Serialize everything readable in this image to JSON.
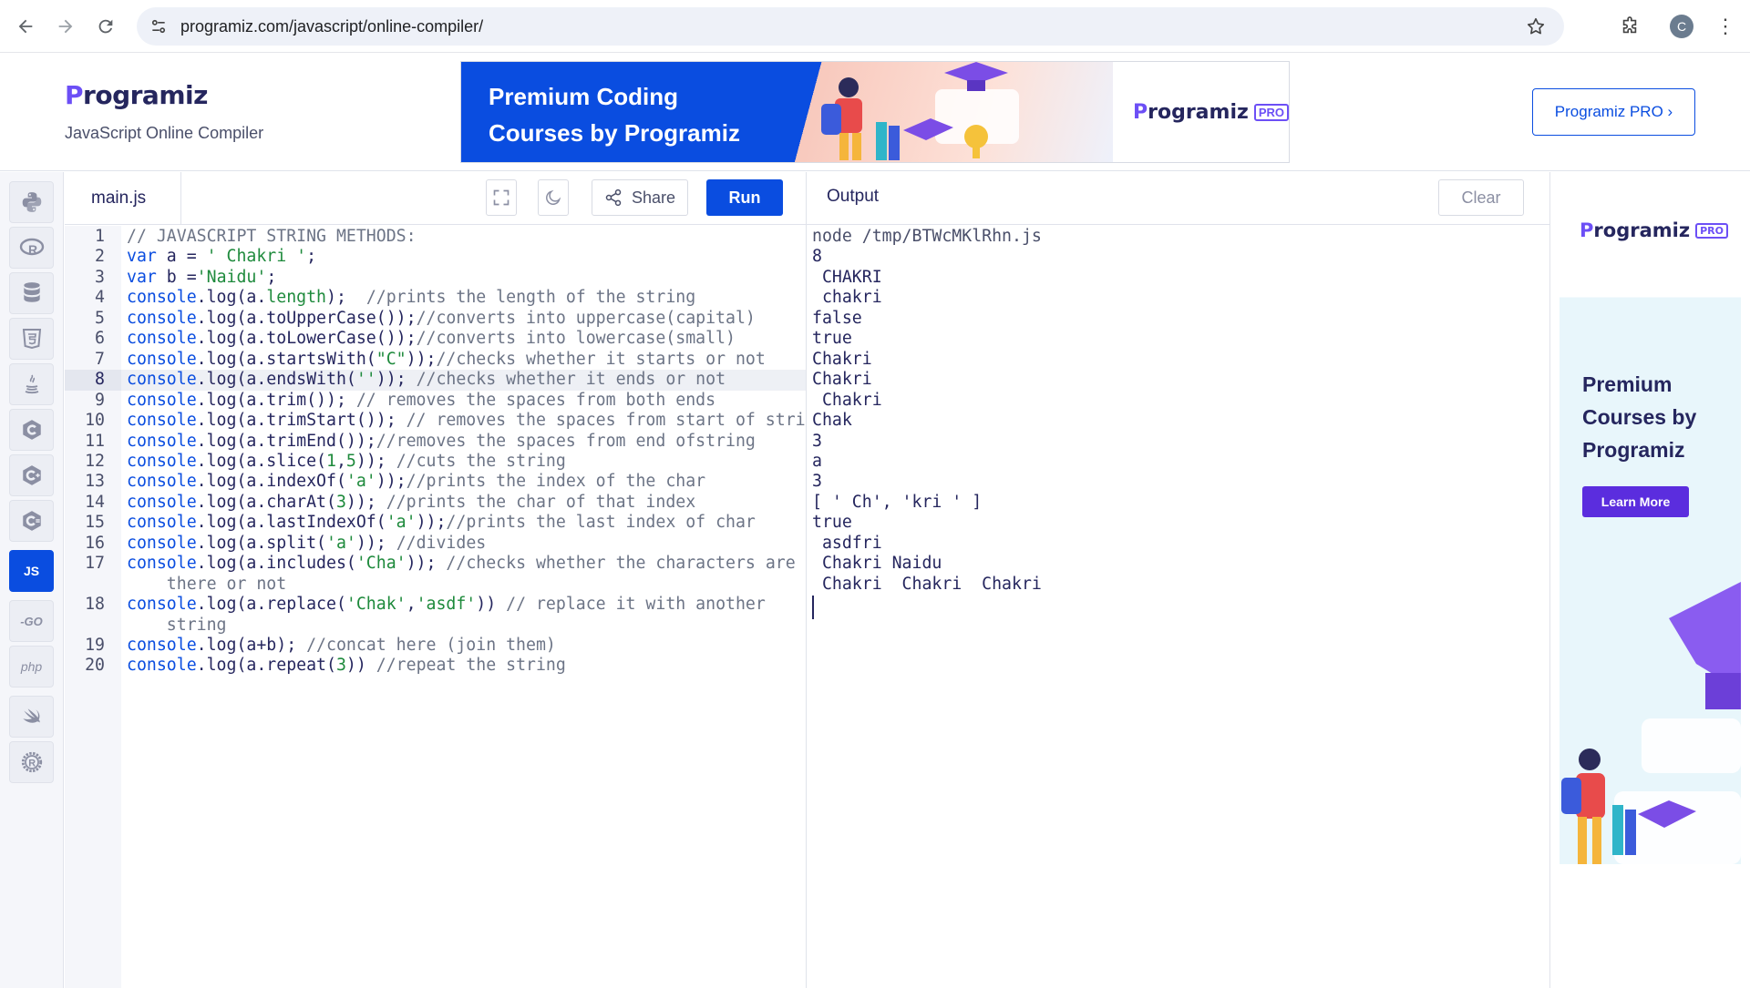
{
  "browser": {
    "url": "programiz.com/javascript/online-compiler/",
    "profile_initial": "C"
  },
  "header": {
    "logo_text": "rogramiz",
    "logo_mark": "P",
    "subtitle": "JavaScript Online Compiler",
    "banner_line1": "Premium Coding",
    "banner_line2": "Courses by Programiz",
    "banner_logo": "rogramiz",
    "banner_badge": "PRO",
    "pro_button": "Programiz PRO ›"
  },
  "rail": {
    "items": [
      "python",
      "r",
      "sql",
      "html",
      "java",
      "c",
      "cpp",
      "csharp",
      "JS",
      "GO",
      "php",
      "swift",
      "rust"
    ],
    "active": "JS",
    "go_label": "-GO",
    "php_label": "php"
  },
  "editor": {
    "file_name": "main.js",
    "share_label": "Share",
    "run_label": "Run",
    "current_line": 8,
    "lines": [
      {
        "n": "1",
        "text": "// JAVASCRIPT STRING METHODS:"
      },
      {
        "n": "2",
        "text": "var a = ' Chakri ';"
      },
      {
        "n": "3",
        "text": "var b ='Naidu';"
      },
      {
        "n": "4",
        "text": "console.log(a.length);  //prints the length of the string"
      },
      {
        "n": "5",
        "text": "console.log(a.toUpperCase());//converts into uppercase(capital)"
      },
      {
        "n": "6",
        "text": "console.log(a.toLowerCase());//converts into lowercase(small)"
      },
      {
        "n": "7",
        "text": "console.log(a.startsWith(\"C\"));//checks whether it starts or not"
      },
      {
        "n": "8",
        "text": "console.log(a.endsWith('')); //checks whether it ends or not"
      },
      {
        "n": "9",
        "text": "console.log(a.trim()); // removes the spaces from both ends"
      },
      {
        "n": "10",
        "text": "console.log(a.trimStart()); // removes the spaces from start of string"
      },
      {
        "n": "11",
        "text": "console.log(a.trimEnd());//removes the spaces from end ofstring"
      },
      {
        "n": "12",
        "text": "console.log(a.slice(1,5)); //cuts the string"
      },
      {
        "n": "13",
        "text": "console.log(a.indexOf('a'));//prints the index of the char"
      },
      {
        "n": "14",
        "text": "console.log(a.charAt(3)); //prints the char of that index"
      },
      {
        "n": "15",
        "text": "console.log(a.lastIndexOf('a'));//prints the last index of char"
      },
      {
        "n": "16",
        "text": "console.log(a.split('a')); //divides"
      },
      {
        "n": "17",
        "text": "console.log(a.includes('Cha')); //checks whether the characters are"
      },
      {
        "n": "",
        "text": "    there or not"
      },
      {
        "n": "18",
        "text": "console.log(a.replace('Chak','asdf')) // replace it with another"
      },
      {
        "n": "",
        "text": "    string"
      },
      {
        "n": "19",
        "text": "console.log(a+b); //concat here (join them)"
      },
      {
        "n": "20",
        "text": "console.log(a.repeat(3)) //repeat the string"
      }
    ]
  },
  "output": {
    "title": "Output",
    "clear_label": "Clear",
    "lines": [
      "node /tmp/BTWcMKlRhn.js",
      "8",
      " CHAKRI ",
      " chakri ",
      "false",
      "true",
      "Chakri",
      "Chakri ",
      " Chakri",
      "Chak",
      "3",
      "a",
      "3",
      "[ ' Ch', 'kri ' ]",
      "true",
      " asdfri ",
      " Chakri Naidu",
      " Chakri  Chakri  Chakri "
    ]
  },
  "ad": {
    "logo": "rogramiz",
    "badge": "PRO",
    "title": "Premium Courses by Programiz",
    "button": "Learn More"
  },
  "colors": {
    "brand_blue": "#0a4de0",
    "brand_purple": "#6c4ff6",
    "text_dark": "#25265e"
  }
}
